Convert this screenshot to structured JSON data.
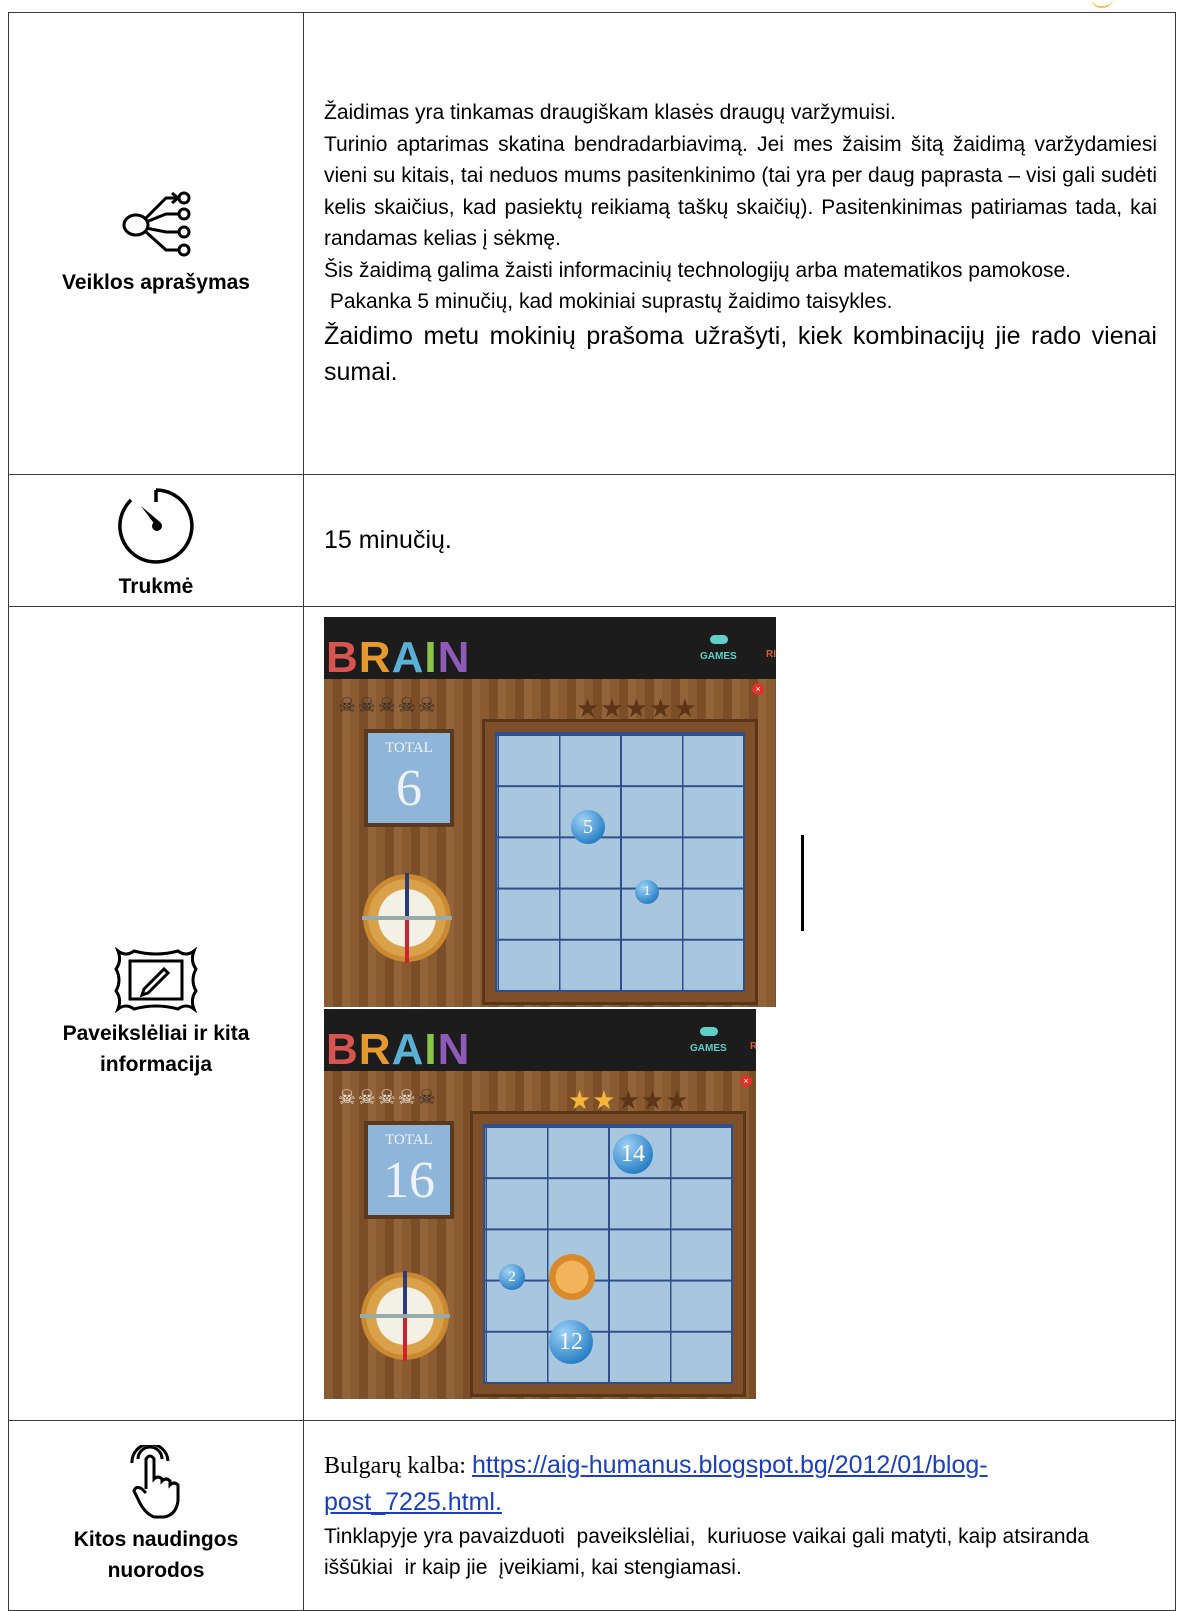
{
  "rows": [
    {
      "label": "Veiklos aprašymas",
      "icon": "network-branch-icon",
      "paragraphs": [
        "Žaidimas yra tinkamas draugiškam klasės draugų varžymuisi.",
        "Turinio aptarimas skatina bendradarbiavimą. Jei mes žaisim šitą žaidimą varžydamiesi vieni su kitais, tai neduos mums pasitenkinimo (tai yra per daug paprasta – visi gali sudėti kelis skaičius, kad pasiektų reikiamą taškų skaičių). Pasitenkinimas patiriamas tada, kai randamas kelias į sėkmę.",
        "Šis žaidimą galima žaisti informacinių technologijų arba matematikos pamokose.",
        " Pakanka 5 minučių, kad mokiniai suprastų žaidimo taisykles.",
        "Žaidimo metu mokinių prašoma užrašyti, kiek kombinacijų jie rado vienai sumai."
      ]
    },
    {
      "label": "Trukmė",
      "icon": "timer-icon",
      "text": "15 minučių."
    },
    {
      "label_line1": "Paveikslėliai ir kita",
      "label_line2": "informacija",
      "icon": "picture-frame-icon",
      "screenshots": [
        {
          "logo": "BRAIN",
          "nav_games": "GAMES",
          "nav_cut": "RI",
          "total_label": "TOTAL",
          "total_value": "6",
          "skulls_active": 0,
          "stars_filled": 0,
          "bubbles": [
            "5",
            "1"
          ]
        },
        {
          "logo": "BRAIN",
          "nav_games": "GAMES",
          "nav_cut": "R",
          "total_label": "TOTAL",
          "total_value": "16",
          "skulls_active": 4,
          "stars_filled": 2,
          "bubbles": [
            "14",
            "2",
            "12"
          ]
        }
      ]
    },
    {
      "label_line1": "Kitos naudingos",
      "label_line2": "nuorodos",
      "icon": "touch-hand-icon",
      "link_prefix": "Bulgarų kalba: ",
      "link_line1": "https://aig-humanus.blogspot.bg/2012/01/blog-",
      "link_line2": "post_7225.html.",
      "text": "Tinklapyje yra pavaizduoti  paveikslėliai,  kuriuose vaikai gali matyti, kaip atsiranda iššūkiai  ir kaip jie  įveikiami, kai stengiamasi."
    }
  ]
}
